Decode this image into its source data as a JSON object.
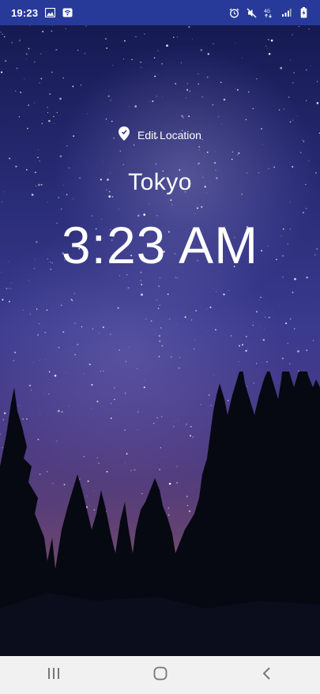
{
  "status_bar": {
    "time": "19:23",
    "icons": [
      "image-icon",
      "wifi-icon",
      "alarm-icon",
      "mute-icon",
      "network-4g-icon",
      "signal-icon",
      "battery-charging-icon"
    ]
  },
  "main": {
    "edit_location_label": "Edit Location",
    "city": "Tokyo",
    "time": "3:23 AM"
  },
  "nav_bar": {
    "buttons": [
      "recent-apps",
      "home",
      "back"
    ]
  },
  "colors": {
    "status_bar_bg": "#273a9a",
    "nav_bar_bg": "#f1f1f1",
    "text": "#ffffff"
  }
}
